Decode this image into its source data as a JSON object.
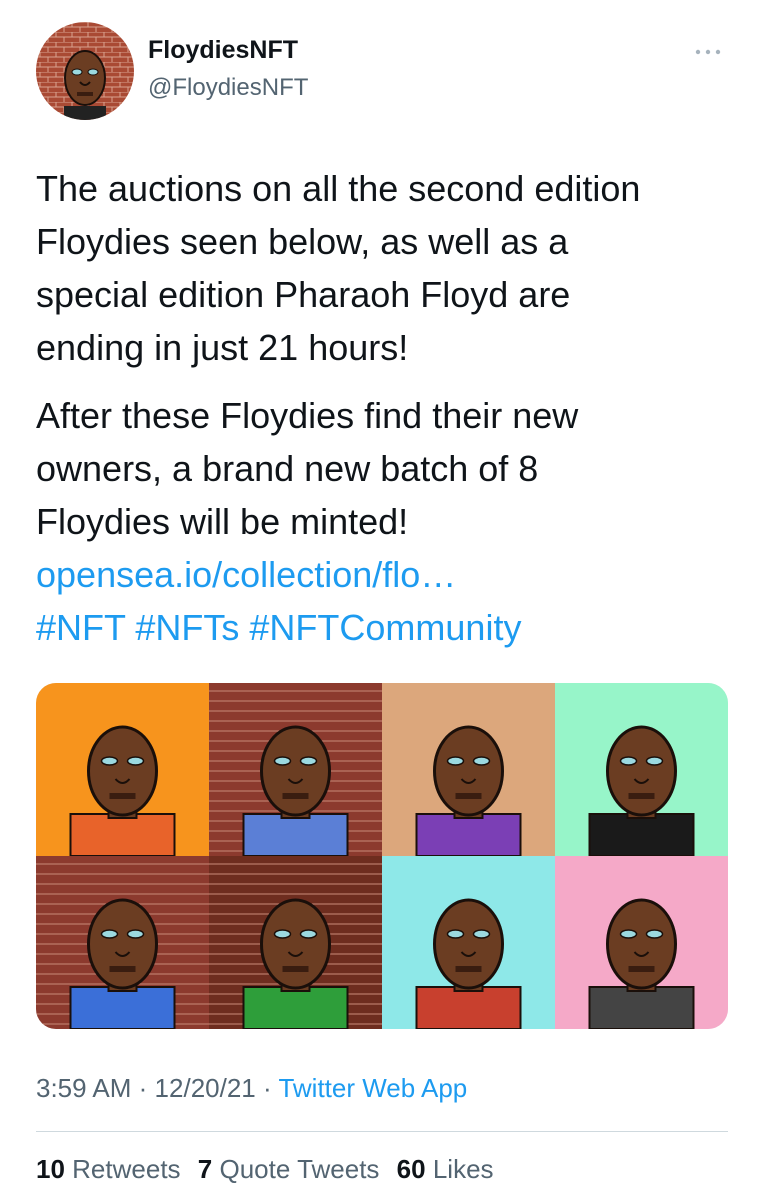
{
  "user": {
    "display_name": "FloydiesNFT",
    "handle": "@FloydiesNFT"
  },
  "tweet": {
    "lines_p1": [
      "The auctions on all the second edition",
      "Floydies seen below, as well as a",
      "special edition Pharaoh Floyd are",
      "ending in just 21 hours!"
    ],
    "lines_p2": [
      "After these Floydies find their new",
      "owners, a brand new batch of 8",
      "Floydies will be minted!"
    ],
    "link": "opensea.io/collection/flo…",
    "hashtags": [
      "#NFT",
      "#NFTs",
      "#NFTCommunity"
    ]
  },
  "media": {
    "tiles": [
      {
        "bg": "#f7941d",
        "shirt": "#e8632a"
      },
      {
        "bg": "#8c3a2e",
        "shirt": "#5b7fd6"
      },
      {
        "bg": "#dca77c",
        "shirt": "#7b3fb5"
      },
      {
        "bg": "#97f5c9",
        "shirt": "#1a1a1a"
      },
      {
        "bg": "#8c3a2e",
        "shirt": "#3b6fd8"
      },
      {
        "bg": "#6e2d1f",
        "shirt": "#2e9e3a"
      },
      {
        "bg": "#8ee8e8",
        "shirt": "#c8402e"
      },
      {
        "bg": "#f5a9c8",
        "shirt": "#444444"
      }
    ]
  },
  "meta": {
    "time": "3:59 AM",
    "separator": "·",
    "date": "12/20/21",
    "app": "Twitter Web App"
  },
  "stats": {
    "retweets_count": "10",
    "retweets_label": "Retweets",
    "quotes_count": "7",
    "quotes_label": "Quote Tweets",
    "likes_count": "60",
    "likes_label": "Likes"
  },
  "colors": {
    "link": "#1d9bf0",
    "secondary_text": "#536471",
    "primary_text": "#0f1419",
    "divider": "#cfd9de"
  },
  "icons": {
    "more": "more-horizontal-icon"
  }
}
